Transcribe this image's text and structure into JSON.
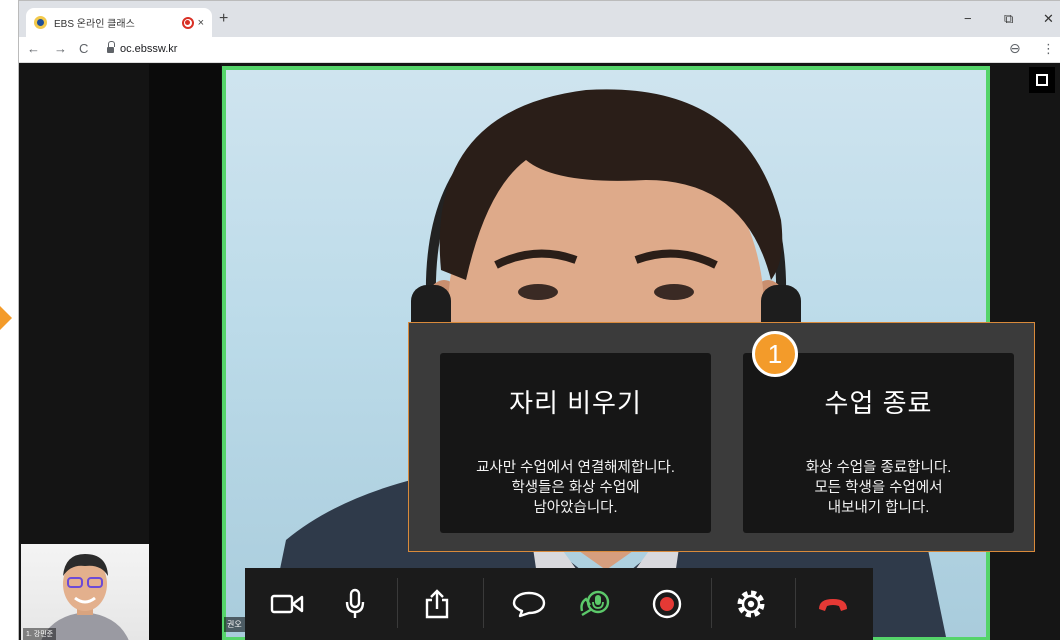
{
  "browser": {
    "tab_title": "EBS 온라인 클래스",
    "tab_close": "×",
    "new_tab": "+",
    "url": "oc.ebssw.kr",
    "back": "←",
    "forward": "→",
    "reload": "C",
    "minimize": "−",
    "restore": "⧉",
    "close": "✕",
    "profile": "⊖",
    "menu": "⋮"
  },
  "video": {
    "main_participant_label": "권오",
    "thumbnail_participant_label": "1. 강민준",
    "border_color": "#55d46a"
  },
  "dialog": {
    "badge_number": "1",
    "leave_seat": {
      "title": "자리 비우기",
      "description": "교사만 수업에서 연결해제합니다.\n학생들은 화상 수업에\n남아았습니다."
    },
    "end_class": {
      "title": "수업 종료",
      "description": "화상 수업을 종료합니다.\n모든 학생을 수업에서\n내보내기 합니다."
    }
  },
  "controls": [
    {
      "name": "camera-icon"
    },
    {
      "name": "microphone-icon"
    },
    {
      "name": "share-icon"
    },
    {
      "name": "chat-icon"
    },
    {
      "name": "mic-permission-icon"
    },
    {
      "name": "record-icon"
    },
    {
      "name": "settings-icon"
    },
    {
      "name": "hangup-icon"
    }
  ],
  "colors": {
    "accent_orange": "#f39b2a",
    "hangup_red": "#e53935",
    "active_green": "#5cc96a"
  }
}
